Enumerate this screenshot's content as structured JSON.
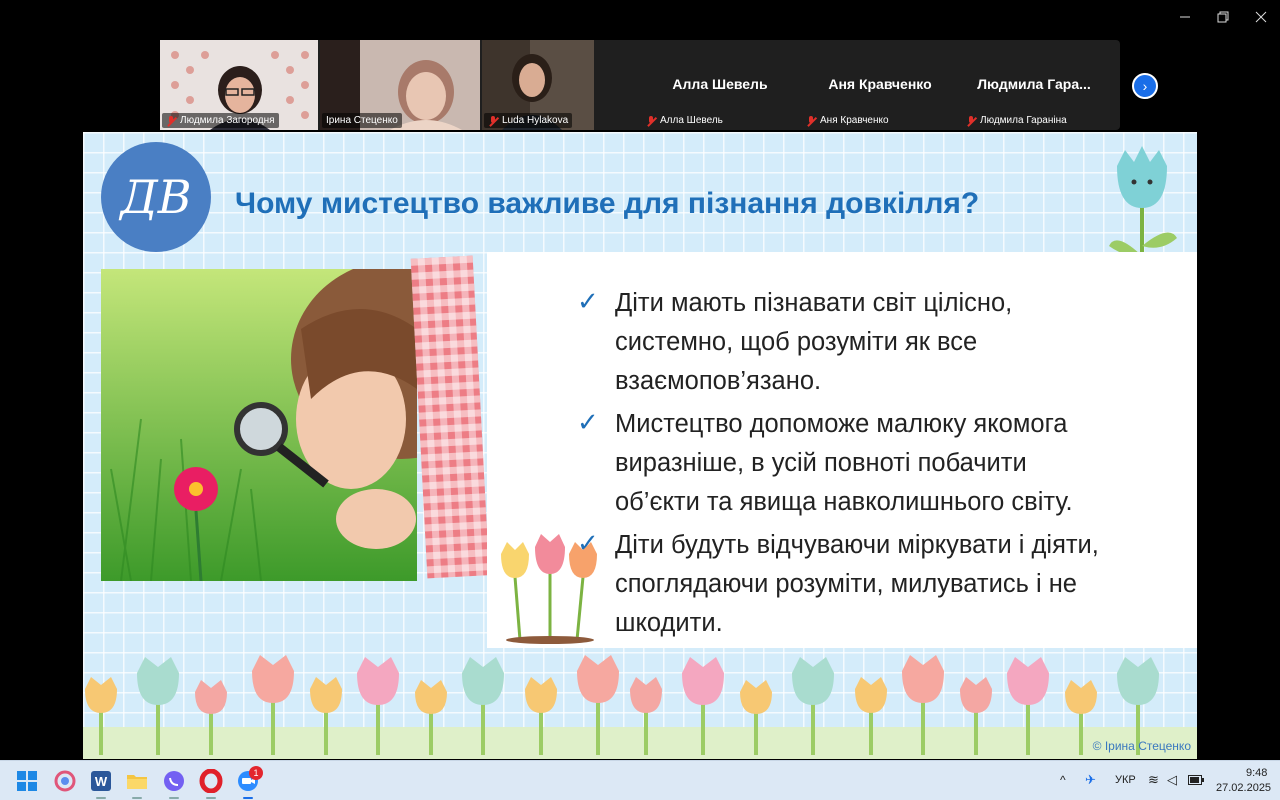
{
  "participants": [
    {
      "name": "Людмила Загородня",
      "video": true
    },
    {
      "name": "Ірина Стеценко",
      "video": true,
      "active": true
    },
    {
      "name": "Luda Hylakova",
      "video": true
    },
    {
      "name": "Алла Шевель",
      "display_name": "Алла Шевель",
      "video": false
    },
    {
      "name": "Аня Кравченко",
      "display_name": "Аня Кравченко",
      "video": false
    },
    {
      "name": "Людмила Гараніна",
      "display_name": "Людмила  Гара...",
      "video": false
    }
  ],
  "slide": {
    "logo_text": "ДВ",
    "title": "Чому мистецтво важливе для пізнання довкілля?",
    "bullets": [
      {
        "lines": [
          "Діти мають пізнавати світ цілісно,",
          "системно, щоб розуміти як все",
          "взаємопов’язано."
        ]
      },
      {
        "lines": [
          "Мистецтво допоможе малюку якомога",
          "виразніше, в усій повноті побачити",
          "об’єкти та явища навколишнього світу."
        ]
      },
      {
        "lines": [
          "Діти будуть відчуваючи міркувати і діяти,",
          "споглядаючи розуміти, милуватись і не",
          "шкодити."
        ]
      }
    ],
    "copyright": "© Ірина Стеценко"
  },
  "taskbar": {
    "language": "УКР",
    "time": "9:48",
    "date": "27.02.2025",
    "badge": "1"
  },
  "icons": [
    "windows-start-icon",
    "copilot-icon",
    "word-icon",
    "file-explorer-icon",
    "viber-icon",
    "opera-icon",
    "zoom-icon"
  ],
  "colors": {
    "title": "#1f6fb8",
    "active_speaker": "#2fd04a",
    "slide_bg": "#d4ecfa"
  }
}
